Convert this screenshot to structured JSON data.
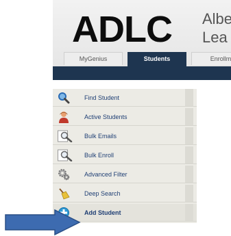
{
  "header": {
    "logo": "ADLC",
    "org_line1": "Albe",
    "org_line2": "Lea"
  },
  "tabs": [
    {
      "label": "MyGenius",
      "active": false
    },
    {
      "label": "Students",
      "active": true
    },
    {
      "label": "Enrollm",
      "active": false
    }
  ],
  "menu": {
    "items": [
      {
        "label": "Find Student",
        "icon": "magnifier-icon"
      },
      {
        "label": "Active Students",
        "icon": "person-icon"
      },
      {
        "label": "Bulk Emails",
        "icon": "search-document-icon"
      },
      {
        "label": "Bulk Enroll",
        "icon": "search-document-icon"
      },
      {
        "label": "Advanced Filter",
        "icon": "gears-icon"
      },
      {
        "label": "Deep Search",
        "icon": "broom-icon"
      },
      {
        "label": "Add Student",
        "icon": "add-circle-icon",
        "selected": true
      }
    ]
  },
  "colors": {
    "navbar": "#1e3550",
    "menu_bg": "#ecebe5",
    "link": "#1f3f74",
    "arrow": "#3d6bb0"
  },
  "annotation": {
    "icon": "right-arrow-icon"
  }
}
